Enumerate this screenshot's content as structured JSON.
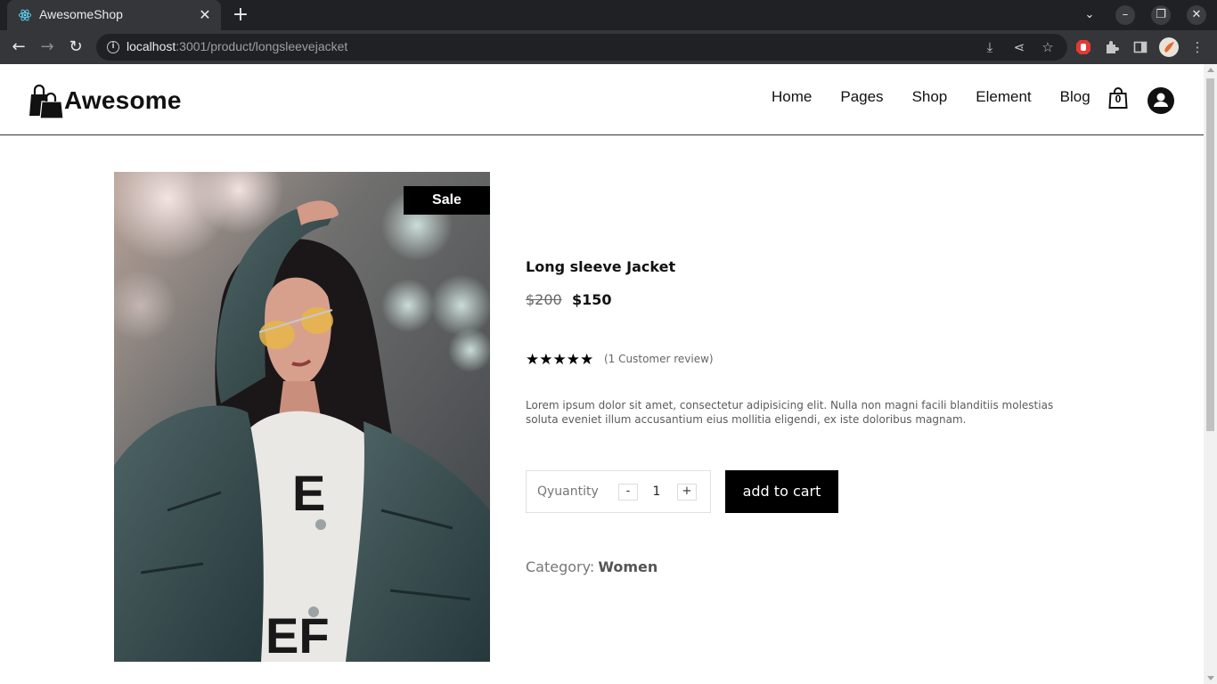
{
  "browser": {
    "tab_title": "AwesomeShop",
    "url_host": "localhost",
    "url_rest": ":3001/product/longsleevejacket"
  },
  "site": {
    "logo_text": "Awesome",
    "menu": [
      "Home",
      "Pages",
      "Shop",
      "Element",
      "Blog"
    ],
    "cart_count": "0"
  },
  "product": {
    "badge": "Sale",
    "name": "Long sleeve Jacket",
    "old_price": "$200",
    "price": "$150",
    "rating": 5,
    "stars": "★★★★★",
    "reviews": "(1 Customer review)",
    "description": "Lorem ipsum dolor sit amet, consectetur adipisicing elit. Nulla non magni facili blanditiis molestias soluta eveniet illum accusantium eius mollitia eligendi, ex iste doloribus magnam.",
    "quantity_label": "Qyuantity",
    "quantity": "1",
    "decrement": "-",
    "increment": "+",
    "add_to_cart": "add to cart",
    "category_label": "Category:",
    "category": "Women"
  },
  "colors": {
    "accent": "#000000",
    "chrome_dark": "#202124",
    "chrome_tab": "#35363a"
  }
}
